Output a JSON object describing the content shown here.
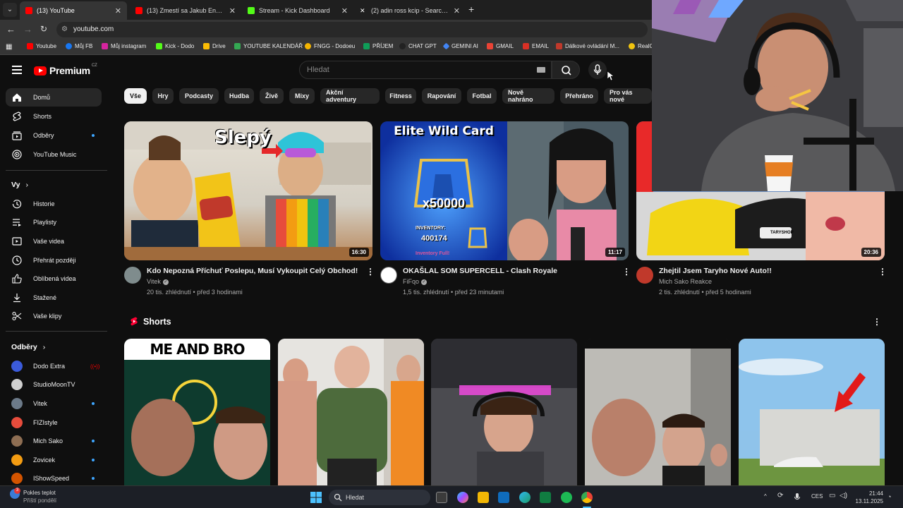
{
  "browser": {
    "tabs": [
      {
        "title": "(13) YouTube",
        "active": true,
        "fav_color": "#ff0000"
      },
      {
        "title": "(13) Zmestí sa Jakub Enži do La",
        "active": false,
        "fav_color": "#ff0000"
      },
      {
        "title": "Stream - Kick Dashboard",
        "active": false,
        "fav_color": "#53fc18"
      },
      {
        "title": "(2) adin ross kcip - Search / X",
        "active": false,
        "fav_color": "#ffffff"
      }
    ],
    "url": "youtube.com",
    "bookmarks": [
      {
        "label": "Youtube",
        "color": "#ff0000"
      },
      {
        "label": "Můj FB",
        "color": "#1877f2"
      },
      {
        "label": "Můj instagram",
        "color": "#d6249f"
      },
      {
        "label": "Kick - Dodo",
        "color": "#53fc18"
      },
      {
        "label": "Drive",
        "color": "#fbbc04"
      },
      {
        "label": "YOUTUBE KALENDÁŘ",
        "color": "#34a853"
      },
      {
        "label": "FNGG - Dodoeu",
        "color": "#f4b400"
      },
      {
        "label": "PŘÍJEM",
        "color": "#0f9d58"
      },
      {
        "label": "CHAT GPT",
        "color": "#222222"
      },
      {
        "label": "GEMINI AI",
        "color": "#4285f4"
      },
      {
        "label": "GMAIL",
        "color": "#ea4335"
      },
      {
        "label": "EMAIL",
        "color": "#d93025"
      },
      {
        "label": "Dálkové ovládání M...",
        "color": "#c0392b"
      },
      {
        "label": "RealG",
        "color": "#f1c40f"
      }
    ]
  },
  "masthead": {
    "logo": "Premium",
    "region": "CZ",
    "search_placeholder": "Hledat"
  },
  "sidebar": {
    "main": [
      {
        "label": "Domů",
        "icon": "home-icon",
        "active": true
      },
      {
        "label": "Shorts",
        "icon": "shorts-icon"
      },
      {
        "label": "Odběry",
        "icon": "subscriptions-icon",
        "dot": true
      },
      {
        "label": "YouTube Music",
        "icon": "music-icon"
      }
    ],
    "you_heading": "Vy",
    "you": [
      {
        "label": "Historie",
        "icon": "history-icon"
      },
      {
        "label": "Playlisty",
        "icon": "playlist-icon"
      },
      {
        "label": "Vaše videa",
        "icon": "video-icon"
      },
      {
        "label": "Přehrát později",
        "icon": "clock-icon"
      },
      {
        "label": "Oblíbená videa",
        "icon": "like-icon"
      },
      {
        "label": "Stažené",
        "icon": "download-icon"
      },
      {
        "label": "Vaše klipy",
        "icon": "scissors-icon"
      }
    ],
    "subs_heading": "Odběry",
    "subs": [
      {
        "label": "Dodo Extra",
        "color": "#3b5bdb",
        "live": true
      },
      {
        "label": "StudioMoonTV",
        "color": "#cfcfcf"
      },
      {
        "label": "Vitek",
        "color": "#6c7a89",
        "dot": true
      },
      {
        "label": "FIZIstyle",
        "color": "#e74c3c"
      },
      {
        "label": "Mich Sako",
        "color": "#8e6e53",
        "dot": true
      },
      {
        "label": "Zovicek",
        "color": "#f39c12",
        "dot": true
      },
      {
        "label": "IShowSpeed",
        "color": "#d35400",
        "dot": true
      }
    ]
  },
  "chips": [
    "Vše",
    "Hry",
    "Podcasty",
    "Hudba",
    "Živě",
    "Mixy",
    "Akční adventury",
    "Fitness",
    "Rapování",
    "Fotbal",
    "Nově nahráno",
    "Přehráno",
    "Pro vás nové"
  ],
  "videos": [
    {
      "title": "Kdo Nepozná Příchuť Poslepu, Musí Vykoupit Celý Obchod!",
      "channel": "Vitek",
      "verified": true,
      "meta": "20 tis. zhlédnutí • před 3 hodinami",
      "duration": "16:30",
      "thumb_text": "Slepý",
      "av_color": "#7f8c8d"
    },
    {
      "title": "OKAŠLAL SOM SUPERCELL - Clash Royale",
      "channel": "FiFqo",
      "verified": true,
      "meta": "1,5 tis. zhlédnutí • před 23 minutami",
      "duration": "11:17",
      "thumb_text": "Elite Wild Card",
      "thumb_sub": "x50000",
      "thumb_inv": "INVENTORY:",
      "thumb_num": "400174",
      "thumb_full": "Inventory Full!",
      "av_color": "#ffffff"
    },
    {
      "title": "Zhejtil Jsem Taryho Nové Auto!!",
      "channel": "Mich Sako Reakce",
      "verified": false,
      "meta": "2 tis. zhlédnutí • před 5 hodinami",
      "duration": "20:36",
      "thumb_badge": "TARYSHOP",
      "av_color": "#c0392b"
    }
  ],
  "shorts": {
    "title": "Shorts",
    "items": [
      {
        "caption": "ME AND BRO"
      },
      {
        "caption": ""
      },
      {
        "caption": ""
      },
      {
        "caption": ""
      },
      {
        "caption": ""
      }
    ]
  },
  "taskbar": {
    "weather_title": "Pokles teplot",
    "weather_sub": "Příští pondělí",
    "weather_badge": "3",
    "search_placeholder": "Hledat",
    "lang": "CES",
    "time": "21:44",
    "date": "13.11.2025"
  }
}
